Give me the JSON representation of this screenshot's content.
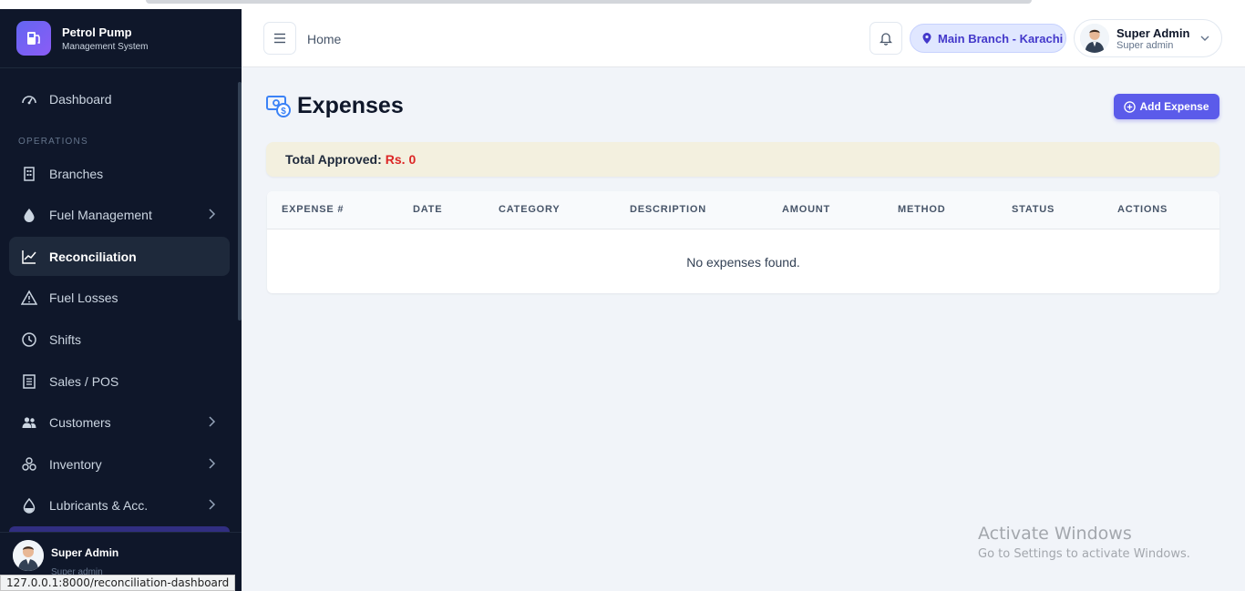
{
  "brand": {
    "title": "Petrol Pump",
    "subtitle": "Management System"
  },
  "sidebar": {
    "section_label": "OPERATIONS",
    "items": [
      {
        "label": "Dashboard",
        "icon": "gauge-icon"
      },
      {
        "label": "Branches",
        "icon": "building-icon"
      },
      {
        "label": "Fuel Management",
        "icon": "droplet-icon",
        "expandable": true
      },
      {
        "label": "Reconciliation",
        "icon": "chart-line-icon",
        "active": true
      },
      {
        "label": "Fuel Losses",
        "icon": "warning-icon"
      },
      {
        "label": "Shifts",
        "icon": "clock-icon"
      },
      {
        "label": "Sales / POS",
        "icon": "receipt-icon"
      },
      {
        "label": "Customers",
        "icon": "users-icon",
        "expandable": true
      },
      {
        "label": "Inventory",
        "icon": "boxes-icon",
        "expandable": true
      },
      {
        "label": "Lubricants & Acc.",
        "icon": "oil-drop-icon",
        "expandable": true
      }
    ],
    "footer": {
      "name": "Super Admin",
      "role": "Super admin"
    }
  },
  "status_url": "127.0.0.1:8000/reconciliation-dashboard",
  "header": {
    "breadcrumb": "Home",
    "branch": "Main Branch - Karachi",
    "user": {
      "name": "Super Admin",
      "role": "Super admin"
    }
  },
  "page": {
    "title": "Expenses",
    "add_button": "Add Expense",
    "total_label": "Total Approved:",
    "total_value": "Rs. 0"
  },
  "table": {
    "columns": [
      "EXPENSE #",
      "DATE",
      "CATEGORY",
      "DESCRIPTION",
      "AMOUNT",
      "METHOD",
      "STATUS",
      "ACTIONS"
    ],
    "empty_message": "No expenses found."
  },
  "watermark": {
    "title": "Activate Windows",
    "subtitle": "Go to Settings to activate Windows."
  },
  "colors": {
    "sidebar_bg": "#0f172a",
    "accent": "#5b5bea",
    "total_value": "#dc2626",
    "branch_text": "#4338ca"
  }
}
